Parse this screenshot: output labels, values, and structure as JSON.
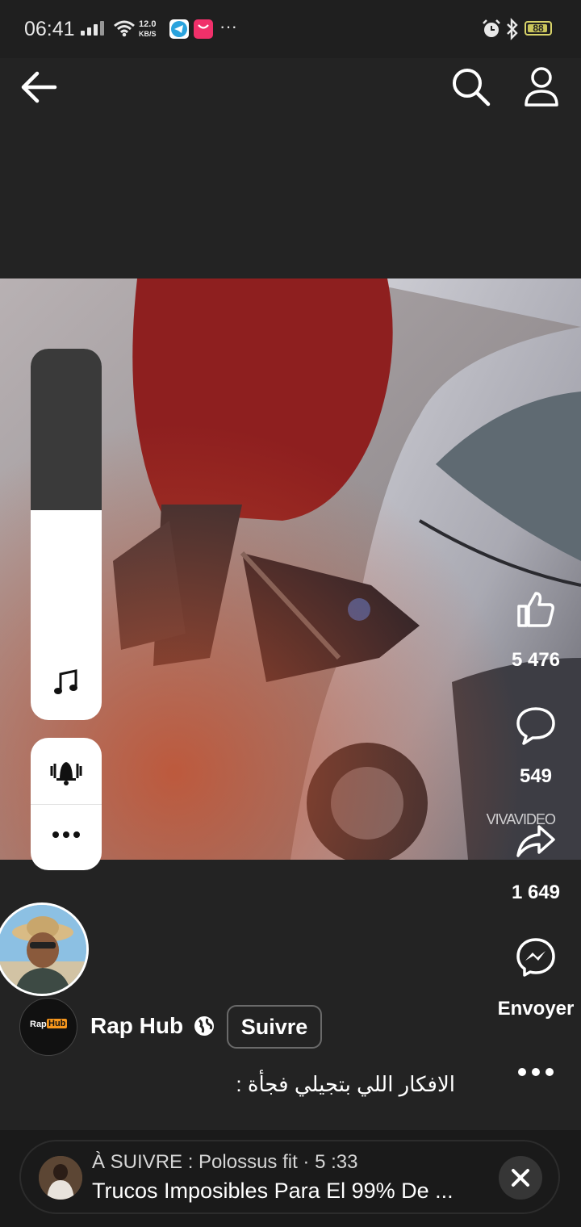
{
  "status_bar": {
    "time": "06:41",
    "net_speed_value": "12.0",
    "net_speed_unit": "KB/S",
    "more": "···",
    "battery": "88"
  },
  "video": {
    "watermark": "VIVAVIDEO"
  },
  "actions": {
    "likes": "5 476",
    "comments": "549",
    "shares": "1 649",
    "send_label": "Envoyer"
  },
  "author": {
    "page_name": "Rap Hub",
    "logo_text_1": "Rap",
    "logo_text_2": "Hub",
    "follow_label": "Suivre",
    "caption": "الافكار اللي بتجيلي فجأة :"
  },
  "up_next": {
    "meta": "À SUIVRE : Polossus fit · 5 :33",
    "title": "Trucos Imposibles Para El 99% De ..."
  },
  "colors": {
    "background": "#232323",
    "panel": "#ffffff",
    "text": "#ffffff"
  }
}
